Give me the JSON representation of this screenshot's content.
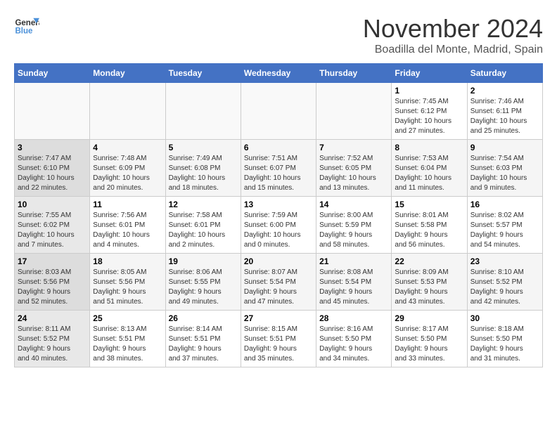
{
  "logo": {
    "line1": "General",
    "line2": "Blue"
  },
  "title": "November 2024",
  "location": "Boadilla del Monte, Madrid, Spain",
  "weekdays": [
    "Sunday",
    "Monday",
    "Tuesday",
    "Wednesday",
    "Thursday",
    "Friday",
    "Saturday"
  ],
  "weeks": [
    [
      {
        "day": "",
        "info": ""
      },
      {
        "day": "",
        "info": ""
      },
      {
        "day": "",
        "info": ""
      },
      {
        "day": "",
        "info": ""
      },
      {
        "day": "",
        "info": ""
      },
      {
        "day": "1",
        "info": "Sunrise: 7:45 AM\nSunset: 6:12 PM\nDaylight: 10 hours\nand 27 minutes."
      },
      {
        "day": "2",
        "info": "Sunrise: 7:46 AM\nSunset: 6:11 PM\nDaylight: 10 hours\nand 25 minutes."
      }
    ],
    [
      {
        "day": "3",
        "info": "Sunrise: 7:47 AM\nSunset: 6:10 PM\nDaylight: 10 hours\nand 22 minutes."
      },
      {
        "day": "4",
        "info": "Sunrise: 7:48 AM\nSunset: 6:09 PM\nDaylight: 10 hours\nand 20 minutes."
      },
      {
        "day": "5",
        "info": "Sunrise: 7:49 AM\nSunset: 6:08 PM\nDaylight: 10 hours\nand 18 minutes."
      },
      {
        "day": "6",
        "info": "Sunrise: 7:51 AM\nSunset: 6:07 PM\nDaylight: 10 hours\nand 15 minutes."
      },
      {
        "day": "7",
        "info": "Sunrise: 7:52 AM\nSunset: 6:05 PM\nDaylight: 10 hours\nand 13 minutes."
      },
      {
        "day": "8",
        "info": "Sunrise: 7:53 AM\nSunset: 6:04 PM\nDaylight: 10 hours\nand 11 minutes."
      },
      {
        "day": "9",
        "info": "Sunrise: 7:54 AM\nSunset: 6:03 PM\nDaylight: 10 hours\nand 9 minutes."
      }
    ],
    [
      {
        "day": "10",
        "info": "Sunrise: 7:55 AM\nSunset: 6:02 PM\nDaylight: 10 hours\nand 7 minutes."
      },
      {
        "day": "11",
        "info": "Sunrise: 7:56 AM\nSunset: 6:01 PM\nDaylight: 10 hours\nand 4 minutes."
      },
      {
        "day": "12",
        "info": "Sunrise: 7:58 AM\nSunset: 6:01 PM\nDaylight: 10 hours\nand 2 minutes."
      },
      {
        "day": "13",
        "info": "Sunrise: 7:59 AM\nSunset: 6:00 PM\nDaylight: 10 hours\nand 0 minutes."
      },
      {
        "day": "14",
        "info": "Sunrise: 8:00 AM\nSunset: 5:59 PM\nDaylight: 9 hours\nand 58 minutes."
      },
      {
        "day": "15",
        "info": "Sunrise: 8:01 AM\nSunset: 5:58 PM\nDaylight: 9 hours\nand 56 minutes."
      },
      {
        "day": "16",
        "info": "Sunrise: 8:02 AM\nSunset: 5:57 PM\nDaylight: 9 hours\nand 54 minutes."
      }
    ],
    [
      {
        "day": "17",
        "info": "Sunrise: 8:03 AM\nSunset: 5:56 PM\nDaylight: 9 hours\nand 52 minutes."
      },
      {
        "day": "18",
        "info": "Sunrise: 8:05 AM\nSunset: 5:56 PM\nDaylight: 9 hours\nand 51 minutes."
      },
      {
        "day": "19",
        "info": "Sunrise: 8:06 AM\nSunset: 5:55 PM\nDaylight: 9 hours\nand 49 minutes."
      },
      {
        "day": "20",
        "info": "Sunrise: 8:07 AM\nSunset: 5:54 PM\nDaylight: 9 hours\nand 47 minutes."
      },
      {
        "day": "21",
        "info": "Sunrise: 8:08 AM\nSunset: 5:54 PM\nDaylight: 9 hours\nand 45 minutes."
      },
      {
        "day": "22",
        "info": "Sunrise: 8:09 AM\nSunset: 5:53 PM\nDaylight: 9 hours\nand 43 minutes."
      },
      {
        "day": "23",
        "info": "Sunrise: 8:10 AM\nSunset: 5:52 PM\nDaylight: 9 hours\nand 42 minutes."
      }
    ],
    [
      {
        "day": "24",
        "info": "Sunrise: 8:11 AM\nSunset: 5:52 PM\nDaylight: 9 hours\nand 40 minutes."
      },
      {
        "day": "25",
        "info": "Sunrise: 8:13 AM\nSunset: 5:51 PM\nDaylight: 9 hours\nand 38 minutes."
      },
      {
        "day": "26",
        "info": "Sunrise: 8:14 AM\nSunset: 5:51 PM\nDaylight: 9 hours\nand 37 minutes."
      },
      {
        "day": "27",
        "info": "Sunrise: 8:15 AM\nSunset: 5:51 PM\nDaylight: 9 hours\nand 35 minutes."
      },
      {
        "day": "28",
        "info": "Sunrise: 8:16 AM\nSunset: 5:50 PM\nDaylight: 9 hours\nand 34 minutes."
      },
      {
        "day": "29",
        "info": "Sunrise: 8:17 AM\nSunset: 5:50 PM\nDaylight: 9 hours\nand 33 minutes."
      },
      {
        "day": "30",
        "info": "Sunrise: 8:18 AM\nSunset: 5:50 PM\nDaylight: 9 hours\nand 31 minutes."
      }
    ]
  ]
}
